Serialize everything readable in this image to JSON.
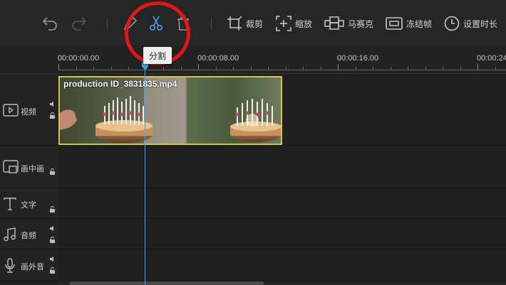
{
  "toolbar": {
    "undo_icon": "undo-icon",
    "redo_icon": "redo-icon",
    "edit_icon": "edit-icon",
    "split_icon": "scissors-icon",
    "delete_icon": "trash-icon",
    "buttons": [
      {
        "label": "裁剪",
        "icon": "crop-icon"
      },
      {
        "label": "缩放",
        "icon": "zoom-icon"
      },
      {
        "label": "马赛克",
        "icon": "mosaic-icon"
      },
      {
        "label": "冻结帧",
        "icon": "freeze-frame-icon"
      },
      {
        "label": "设置时长",
        "icon": "clock-icon"
      }
    ],
    "tooltip": "分割",
    "accent": "#4aa0e6",
    "annotation_color": "#e0161b"
  },
  "ruler": {
    "labels": [
      "00:00:00.00",
      "00:00:08.00",
      "00:00:16.00",
      "00:00:24"
    ]
  },
  "tracks": [
    {
      "label": "视频",
      "icon": "video-track-icon",
      "has_volume": true,
      "has_lock": true
    },
    {
      "label": "画中画",
      "icon": "pip-track-icon",
      "has_volume": false,
      "has_lock": true
    },
    {
      "label": "文字",
      "icon": "text-track-icon",
      "has_volume": false,
      "has_lock": true
    },
    {
      "label": "音频",
      "icon": "music-track-icon",
      "has_volume": true,
      "has_lock": true
    },
    {
      "label": "画外音",
      "icon": "microphone-track-icon",
      "has_volume": true,
      "has_lock": true
    }
  ],
  "clip": {
    "name": "production ID_3831835.mp4",
    "border_color": "#d7c24b"
  }
}
